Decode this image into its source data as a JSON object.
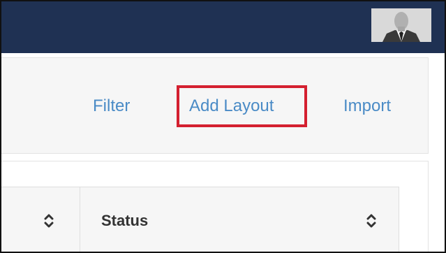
{
  "toolbar": {
    "filter_label": "Filter",
    "add_layout_label": "Add Layout",
    "import_label": "Import"
  },
  "table": {
    "columns": [
      {
        "label": ""
      },
      {
        "label": "Status"
      }
    ]
  },
  "icons": {
    "sort": "sort-icon",
    "avatar": "user-avatar"
  },
  "colors": {
    "navbar": "#1f3153",
    "link": "#4a8bc6",
    "highlight": "#d42030"
  }
}
